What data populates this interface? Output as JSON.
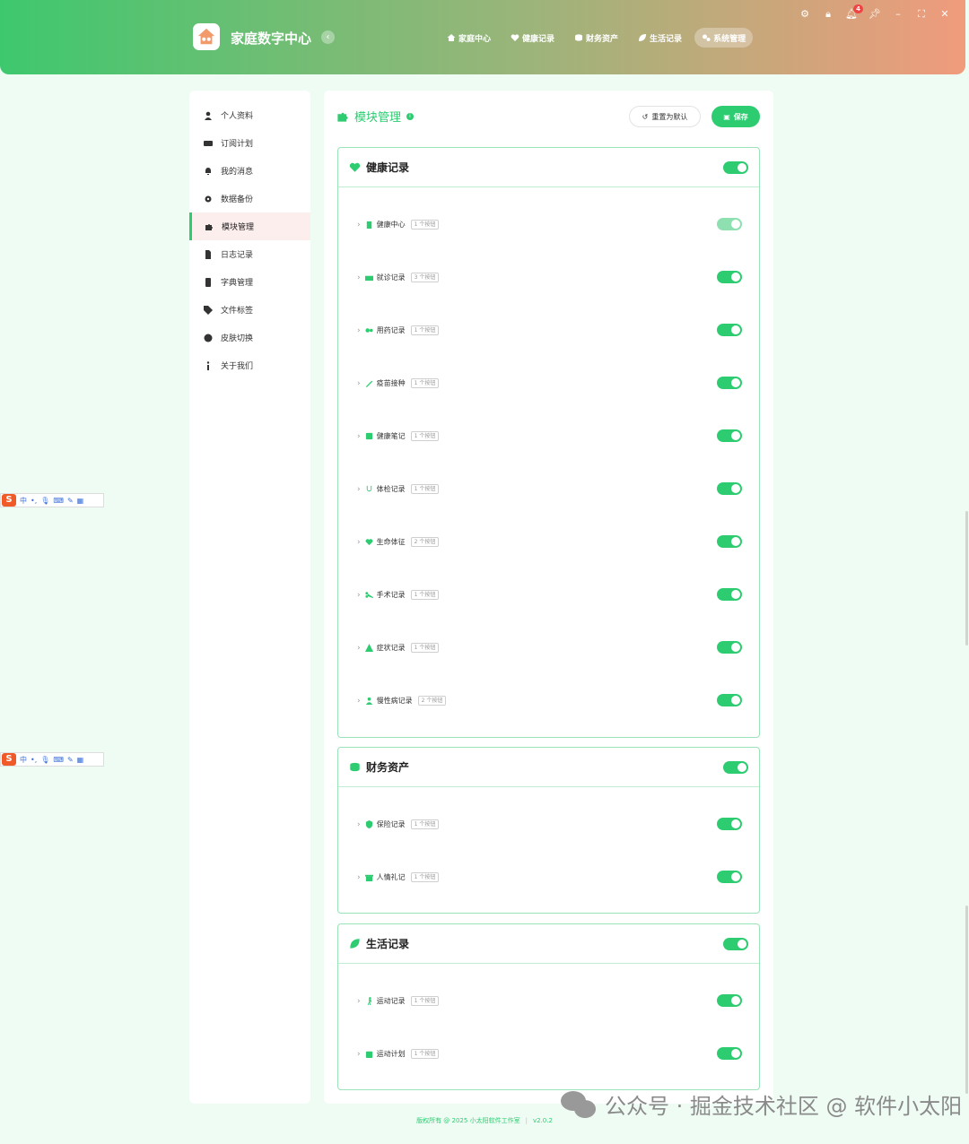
{
  "app": {
    "title": "家庭数字中心"
  },
  "nav": [
    {
      "label": "家庭中心",
      "icon": "home-icon"
    },
    {
      "label": "健康记录",
      "icon": "heart-icon"
    },
    {
      "label": "财务资产",
      "icon": "coins-icon"
    },
    {
      "label": "生活记录",
      "icon": "leaf-icon"
    },
    {
      "label": "系统管理",
      "icon": "gears-icon"
    }
  ],
  "window_controls": {
    "notification_count": "4"
  },
  "sidebar": {
    "items": [
      {
        "label": "个人资料",
        "icon": "user-icon"
      },
      {
        "label": "订阅计划",
        "icon": "card-icon"
      },
      {
        "label": "我的消息",
        "icon": "bell-icon"
      },
      {
        "label": "数据备份",
        "icon": "gear-icon"
      },
      {
        "label": "模块管理",
        "icon": "puzzle-icon"
      },
      {
        "label": "日志记录",
        "icon": "file-icon"
      },
      {
        "label": "字典管理",
        "icon": "book-icon"
      },
      {
        "label": "文件标签",
        "icon": "tag-icon"
      },
      {
        "label": "皮肤切换",
        "icon": "palette-icon"
      },
      {
        "label": "关于我们",
        "icon": "info-icon"
      }
    ]
  },
  "main": {
    "title": "模块管理",
    "reset_label": "重置为默认",
    "save_label": "保存",
    "groups": [
      {
        "title": "健康记录",
        "enabled": true,
        "items": [
          {
            "label": "健康中心",
            "badge": "1 个按钮",
            "enabled": true,
            "disabled": true
          },
          {
            "label": "就诊记录",
            "badge": "3 个按钮",
            "enabled": true
          },
          {
            "label": "用药记录",
            "badge": "1 个按钮",
            "enabled": true
          },
          {
            "label": "疫苗接种",
            "badge": "1 个按钮",
            "enabled": true
          },
          {
            "label": "健康笔记",
            "badge": "1 个按钮",
            "enabled": true
          },
          {
            "label": "体检记录",
            "badge": "1 个按钮",
            "enabled": true
          },
          {
            "label": "生命体征",
            "badge": "2 个按钮",
            "enabled": true
          },
          {
            "label": "手术记录",
            "badge": "1 个按钮",
            "enabled": true
          },
          {
            "label": "症状记录",
            "badge": "1 个按钮",
            "enabled": true
          },
          {
            "label": "慢性病记录",
            "badge": "2 个按钮",
            "enabled": true
          }
        ]
      },
      {
        "title": "财务资产",
        "enabled": true,
        "items": [
          {
            "label": "保险记录",
            "badge": "1 个按钮",
            "enabled": true
          },
          {
            "label": "人情礼记",
            "badge": "1 个按钮",
            "enabled": true
          }
        ]
      },
      {
        "title": "生活记录",
        "enabled": true,
        "items": [
          {
            "label": "运动记录",
            "badge": "1 个按钮",
            "enabled": true
          },
          {
            "label": "运动计划",
            "badge": "1 个按钮",
            "enabled": true
          }
        ]
      }
    ]
  },
  "footer": {
    "copyright": "版权所有 @ 2025 小太阳软件工作室",
    "version": "v2.0.2"
  },
  "ime": {
    "lang": "中"
  },
  "watermark": {
    "text": "公众号 · 掘金技术社区 @ 软件小太阳"
  },
  "colors": {
    "accent": "#2ecc71",
    "header_start": "#3ec86e",
    "header_end": "#f09b7c"
  }
}
